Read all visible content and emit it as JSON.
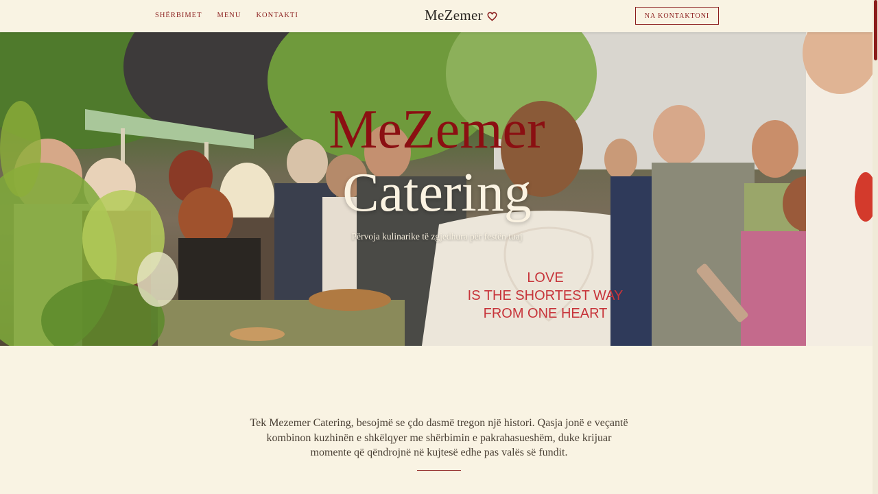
{
  "nav": {
    "items": [
      "SHËRBIMET",
      "MENU",
      "KONTAKTI"
    ]
  },
  "brand": {
    "name": "MeZemer",
    "icon": "heart-icon"
  },
  "cta": {
    "label": "NA KONTAKTONI"
  },
  "hero": {
    "title_line1": "MeZemer",
    "title_line2": "Catering",
    "subtitle": "Përvoja kulinarike të zgjedhura për festën tuaj",
    "shirt_print": [
      "LOVE",
      "IS THE SHORTEST WAY",
      "FROM ONE HEART"
    ]
  },
  "intro": {
    "text": "Tek Mezemer Catering, besojmë se çdo dasmë tregon një histori. Qasja jonë e veçantë kombinon kuzhinën e shkëlqyer me shërbimin e pakrahasueshëm, duke krijuar momente që qëndrojnë në kujtesë edhe pas valës së fundit."
  },
  "colors": {
    "background": "#f9f3e3",
    "accent": "#8a1c1c",
    "hero_title_red": "#8b0f12",
    "hero_title_cream": "#fbf3e2"
  }
}
